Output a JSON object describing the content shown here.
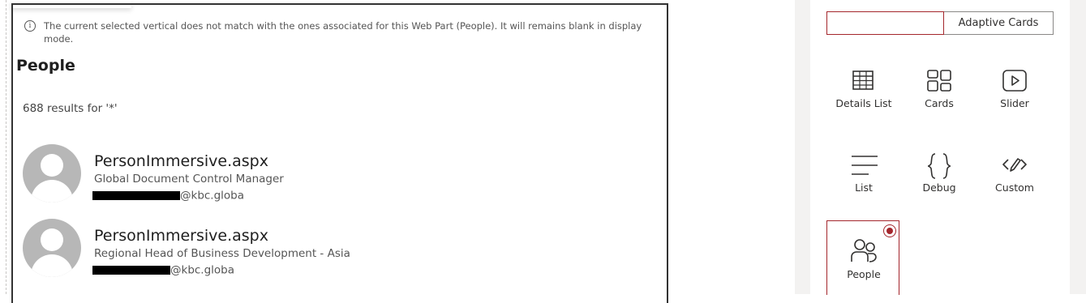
{
  "webpart": {
    "info_message": "The current selected vertical does not match with the ones associated for this Web Part (People). It will remains blank in display mode.",
    "section_title": "People",
    "results_count": "688 results for '*'",
    "people": [
      {
        "name": "PersonImmersive.aspx",
        "title": "Global Document Control Manager",
        "email_domain": "@kbc.globa"
      },
      {
        "name": "PersonImmersive.aspx",
        "title": "Regional Head of Business Development - Asia",
        "email_domain": "@kbc.globa"
      }
    ]
  },
  "property_pane": {
    "template_tabs": {
      "first_label": "",
      "second_label": "Adaptive Cards"
    },
    "layouts": [
      {
        "label": "Details List",
        "icon": "details-list-icon"
      },
      {
        "label": "Cards",
        "icon": "cards-icon"
      },
      {
        "label": "Slider",
        "icon": "slider-icon"
      },
      {
        "label": "List",
        "icon": "list-icon"
      },
      {
        "label": "Debug",
        "icon": "debug-icon"
      },
      {
        "label": "Custom",
        "icon": "custom-icon"
      },
      {
        "label": "People",
        "icon": "people-icon",
        "selected": true
      }
    ],
    "accent_color": "#a4262c"
  }
}
